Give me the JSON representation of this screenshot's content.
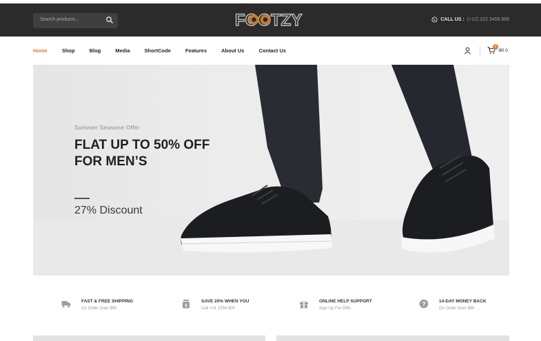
{
  "header": {
    "search_placeholder": "Search products...",
    "logo_text": "FOOTZY",
    "call_label": "CALL US :",
    "call_number": "(+12) 222 3456 888"
  },
  "nav": {
    "items": [
      {
        "label": "Home",
        "active": true
      },
      {
        "label": "Shop",
        "active": false
      },
      {
        "label": "Blog",
        "active": false
      },
      {
        "label": "Media",
        "active": false
      },
      {
        "label": "ShortCode",
        "active": false
      },
      {
        "label": "Features",
        "active": false
      },
      {
        "label": "About Us",
        "active": false
      },
      {
        "label": "Contact Us",
        "active": false
      }
    ],
    "cart_count": "0",
    "cart_total": "-$0.0"
  },
  "hero": {
    "eyebrow": "Summer Seasone Offer",
    "title_line1": "FLAT UP TO 50% OFF",
    "title_line2": "FOR MEN’S",
    "discount": "27% Discount"
  },
  "features": [
    {
      "title": "FAST & FREE SHIPPING",
      "subtitle": "On Order Over $90",
      "icon": "truck-icon"
    },
    {
      "title": "SAVE 20% WHEN YOU",
      "subtitle": "Call +01 2334 600",
      "icon": "money-jar-icon"
    },
    {
      "title": "ONLINE HELP SUPPORT",
      "subtitle": "Sign Up For Gifts",
      "icon": "gift-icon"
    },
    {
      "title": "14-DAY MONEY BACK",
      "subtitle": "On Order Over $90",
      "icon": "help-icon"
    }
  ],
  "colors": {
    "accent": "#e07b2c",
    "topbar": "#2b2b2b",
    "text_dark": "#1f1f1f"
  }
}
